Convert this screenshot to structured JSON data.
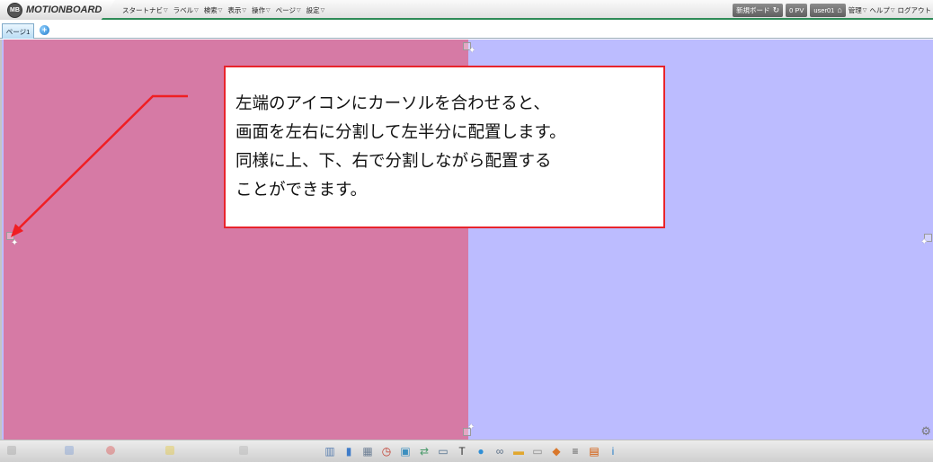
{
  "app": {
    "logo_badge": "MB",
    "logo_text": "MOTIONBOARD"
  },
  "menu": [
    {
      "label": "スタートナビ",
      "caret": "▽"
    },
    {
      "label": "ラベル",
      "caret": "▽"
    },
    {
      "label": "検索",
      "caret": "▽"
    },
    {
      "label": "表示",
      "caret": "▽"
    },
    {
      "label": "操作",
      "caret": "▽"
    },
    {
      "label": "ページ",
      "caret": "▽"
    },
    {
      "label": "設定",
      "caret": "▽"
    }
  ],
  "right_menu": {
    "new_board": "新規ボード",
    "refresh_icon": "↻",
    "pv": "0 PV",
    "user": "user01",
    "home_icon": "⌂",
    "admin": "管理",
    "help": "ヘルプ",
    "logout": "ログアウト",
    "caret": "▽"
  },
  "tabs": {
    "active_tab": "ページ1",
    "add_icon": "+"
  },
  "canvas": {
    "left_color": "#d67aa5",
    "right_color": "#bcbcff",
    "handle_glyph": "✦",
    "gear_glyph": "⚙"
  },
  "callout": {
    "lines": [
      "左端のアイコンにカーソルを合わせると、",
      "画面を左右に分割して左半分に配置します。",
      "同様に上、下、右で分割しながら配置する",
      "ことができます。"
    ],
    "border_color": "#e8242c"
  },
  "toolbar": {
    "tools": [
      {
        "name": "layout-tool-icon",
        "glyph": "▥",
        "color": "#5a7fb0"
      },
      {
        "name": "bar-chart-tool-icon",
        "glyph": "▮",
        "color": "#3f7cc9"
      },
      {
        "name": "table-tool-icon",
        "glyph": "▦",
        "color": "#6d7f95"
      },
      {
        "name": "clock-tool-icon",
        "glyph": "◷",
        "color": "#c0392b"
      },
      {
        "name": "image-tool-icon",
        "glyph": "▣",
        "color": "#3c8fbf"
      },
      {
        "name": "flow-tool-icon",
        "glyph": "⇄",
        "color": "#4a9a6a"
      },
      {
        "name": "window-tool-icon",
        "glyph": "▭",
        "color": "#4f6e8c"
      },
      {
        "name": "text-tool-icon",
        "glyph": "T",
        "color": "#333333"
      },
      {
        "name": "globe-tool-icon",
        "glyph": "●",
        "color": "#2f8fd6"
      },
      {
        "name": "link-tool-icon",
        "glyph": "∞",
        "color": "#5b6f86"
      },
      {
        "name": "folder-tool-icon",
        "glyph": "▬",
        "color": "#e1a72e"
      },
      {
        "name": "button-tool-icon",
        "glyph": "▭",
        "color": "#8c8c8c"
      },
      {
        "name": "shapes-tool-icon",
        "glyph": "◆",
        "color": "#d9772b"
      },
      {
        "name": "list-tool-icon",
        "glyph": "≡",
        "color": "#555555"
      },
      {
        "name": "calendar-tool-icon",
        "glyph": "▤",
        "color": "#d35400"
      },
      {
        "name": "info-tool-icon",
        "glyph": "i",
        "color": "#2b7fc9"
      }
    ]
  }
}
